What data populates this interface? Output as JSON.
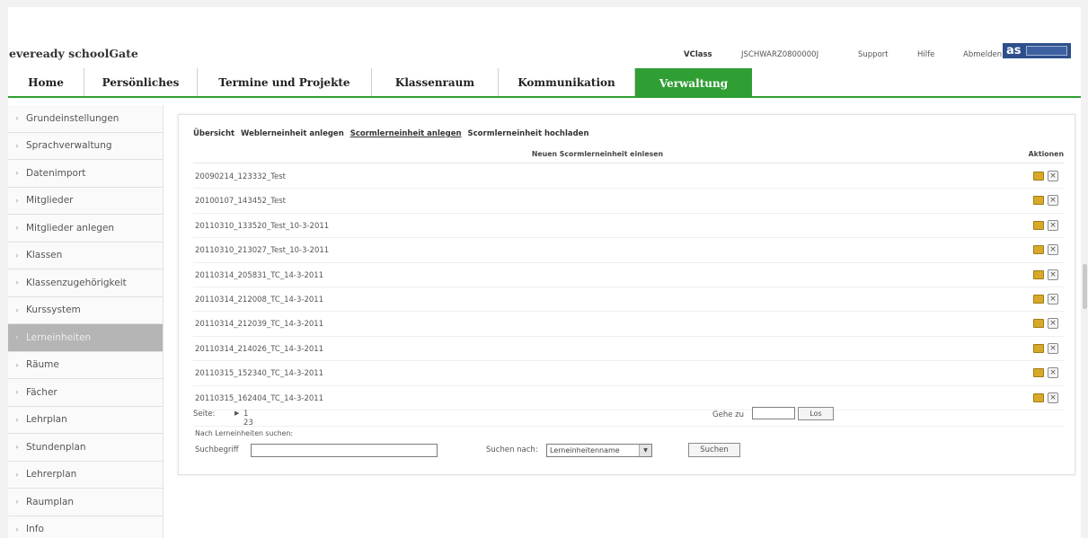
{
  "header": {
    "brand": "eveready schoolGate",
    "class_label": "VClass",
    "user_id": "JSCHWARZ0800000J",
    "support": "Support",
    "help": "Hilfe",
    "logout": "Abmelden",
    "logo_text": "as"
  },
  "nav": {
    "tabs": [
      {
        "label": "Home"
      },
      {
        "label": "Persönliches"
      },
      {
        "label": "Termine und Projekte"
      },
      {
        "label": "Klassenraum"
      },
      {
        "label": "Kommunikation"
      },
      {
        "label": "Verwaltung",
        "active": true
      }
    ]
  },
  "sidebar": {
    "items": [
      {
        "label": "Grundeinstellungen"
      },
      {
        "label": "Sprachverwaltung"
      },
      {
        "label": "Datenimport"
      },
      {
        "label": "Mitglieder"
      },
      {
        "label": "Mitglieder anlegen"
      },
      {
        "label": "Klassen"
      },
      {
        "label": "Klassenzugehörigkeit"
      },
      {
        "label": "Kurssystem"
      },
      {
        "label": "Lerneinheiten",
        "active": true
      },
      {
        "label": "Räume"
      },
      {
        "label": "Fächer"
      },
      {
        "label": "Lehrplan"
      },
      {
        "label": "Stundenplan"
      },
      {
        "label": "Lehrerplan"
      },
      {
        "label": "Raumplan"
      },
      {
        "label": "Info"
      }
    ]
  },
  "subnav": {
    "overview": "Übersicht",
    "web_create": "Weblerneinheit anlegen",
    "scorm_create": "Scormlerneinheit anlegen",
    "scorm_upload": "Scormlerneinheit hochladen"
  },
  "table": {
    "header_center": "Neuen Scormlerneinheit einlesen",
    "header_actions": "Aktionen",
    "rows": [
      "20090214_123332_Test",
      "20100107_143452_Test",
      "20110310_133520_Test_10-3-2011",
      "20110310_213027_Test_10-3-2011",
      "20110314_205831_TC_14-3-2011",
      "20110314_212008_TC_14-3-2011",
      "20110314_212039_TC_14-3-2011",
      "20110314_214026_TC_14-3-2011",
      "20110315_152340_TC_14-3-2011",
      "20110315_162404_TC_14-3-2011"
    ],
    "delete_glyph": "×"
  },
  "pager": {
    "label": "Seite:",
    "arrow": "▶",
    "current": "1",
    "page2": "2",
    "page3": "3",
    "goto_label": "Gehe zu",
    "goto_button": "Los"
  },
  "search": {
    "heading": "Nach Lerneinheiten suchen:",
    "term_label": "Suchbegriff",
    "by_label": "Suchen nach:",
    "by_value": "Lerneinheitenname",
    "button": "Suchen"
  },
  "colors": {
    "accent_green": "#2f9e33",
    "logo_blue": "#2d4f8b"
  }
}
